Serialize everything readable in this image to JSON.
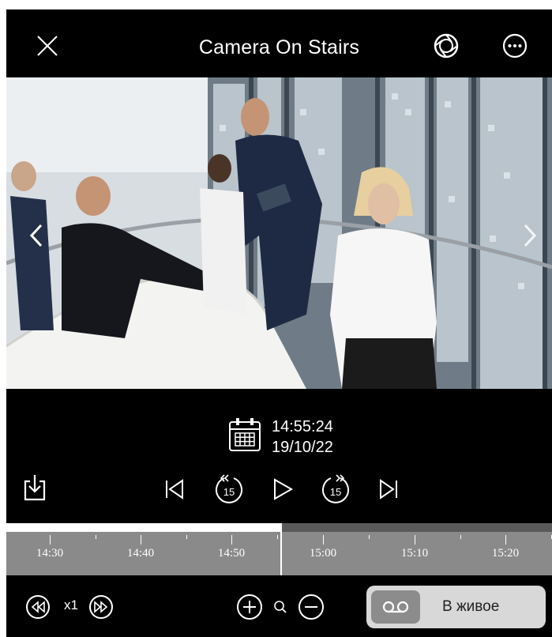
{
  "header": {
    "title": "Camera On Stairs",
    "close_icon": "close-icon",
    "lens_icon": "camera-lens-icon",
    "more_icon": "more-icon"
  },
  "player": {
    "time": "14:55:24",
    "date": "19/10/22",
    "progress_fraction": 0.504
  },
  "controls": {
    "download_icon": "download-icon",
    "skip_start_icon": "skip-to-start-icon",
    "rewind_icon": "rewind-15-icon",
    "rewind_label": "15",
    "play_icon": "play-icon",
    "forward_icon": "forward-15-icon",
    "forward_label": "15",
    "skip_end_icon": "skip-to-end-icon"
  },
  "timeline": {
    "labels": [
      "14:30",
      "14:40",
      "14:50",
      "15:00",
      "15:10",
      "15:20"
    ],
    "current_time": "14:55:24"
  },
  "bottom_bar": {
    "speed_label": "x1",
    "zoom_in_icon": "zoom-in-icon",
    "search_icon": "search-icon",
    "zoom_out_icon": "zoom-out-icon",
    "live_icon": "voicemail-icon",
    "live_label": "В живое"
  },
  "colors": {
    "background": "#000000",
    "timeline": "#8a8a8a",
    "live_button": "#d8d8d8",
    "live_icon_box": "#8c8c8c"
  }
}
